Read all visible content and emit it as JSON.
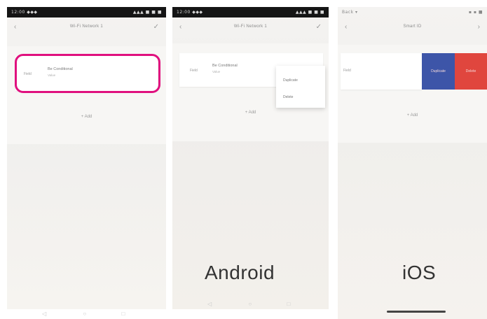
{
  "phones": [
    {
      "status_left": "12:00 ◆◆◆",
      "status_right": "▲▲▲ ■ ■ ■",
      "nav_left": "‹",
      "nav_right": "✓",
      "title": "Wi-Fi Network 1",
      "card_label": "Field",
      "card_main": "Be Conditional",
      "card_sub": "Value",
      "add_label": "+ Add"
    },
    {
      "status_left": "12:00 ◆◆◆",
      "status_right": "▲▲▲ ■ ■ ■",
      "nav_left": "‹",
      "nav_right": "✓",
      "title": "Wi-Fi Network 1",
      "card_label": "Field",
      "card_main": "Be Conditional",
      "card_sub": "Value",
      "add_label": "+ Add",
      "menu_items": [
        "Duplicate",
        "Delete"
      ],
      "platform": "Android"
    },
    {
      "status_left": "Back ▾",
      "status_right": "▪ ▪ ■",
      "nav_left": "‹",
      "nav_right": "›",
      "title": "Smart ID",
      "card_label": "Field",
      "swipe_duplicate": "Duplicate",
      "swipe_delete": "Delete",
      "add_label": "+ Add",
      "platform": "iOS"
    }
  ],
  "colors": {
    "highlight": "#e0107e",
    "swipe_duplicate": "#3d55a8",
    "swipe_delete": "#e0463e"
  }
}
